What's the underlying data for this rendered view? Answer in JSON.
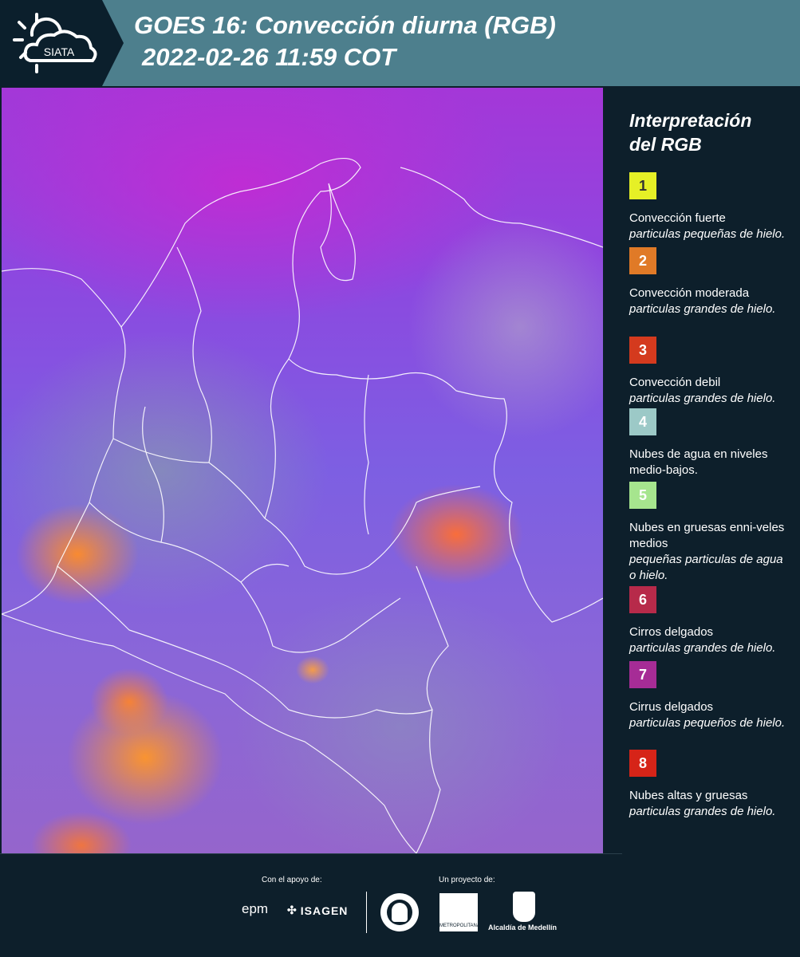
{
  "header": {
    "logo_text": "SIATA",
    "title_line1": "GOES 16: Convección diurna (RGB)",
    "title_line2": "2022-02-26 11:59 COT"
  },
  "legend": {
    "title_line1": "Interpretación",
    "title_line2": "del RGB",
    "items": [
      {
        "num": "1",
        "color": "#e6f026",
        "num_color": "#333333",
        "title": "Convección fuerte",
        "desc": "particulas pequeñas de hielo."
      },
      {
        "num": "2",
        "color": "#e07a27",
        "num_color": "#ffffff",
        "title": "Convección moderada",
        "desc": "particulas grandes de hielo."
      },
      {
        "num": "3",
        "color": "#d43a1e",
        "num_color": "#ffffff",
        "title": "Convección debil",
        "desc": "particulas grandes de hielo."
      },
      {
        "num": "4",
        "color": "#9cc9c7",
        "num_color": "#ffffff",
        "title": "Nubes de agua en niveles medio-bajos.",
        "desc": ""
      },
      {
        "num": "5",
        "color": "#a6e58e",
        "num_color": "#ffffff",
        "title": "Nubes en gruesas enni-veles medios",
        "desc": "pequeñas particulas de agua o hielo."
      },
      {
        "num": "6",
        "color": "#b72a4a",
        "num_color": "#ffffff",
        "title": "Cirros delgados",
        "desc": "particulas grandes de hielo."
      },
      {
        "num": "7",
        "color": "#a62c96",
        "num_color": "#ffffff",
        "title": "Cirrus delgados",
        "desc": "particulas pequeños de hielo."
      },
      {
        "num": "8",
        "color": "#d62418",
        "num_color": "#ffffff",
        "title": "Nubes altas y gruesas",
        "desc": "particulas grandes de hielo."
      }
    ]
  },
  "footer": {
    "support_label": "Con el apoyo de:",
    "project_label": "Un proyecto de:",
    "epm": "epm",
    "isagen": "ISAGEN",
    "area_metro": "METROPOLITANA",
    "alcaldia": "Alcaldía de Medellín"
  }
}
